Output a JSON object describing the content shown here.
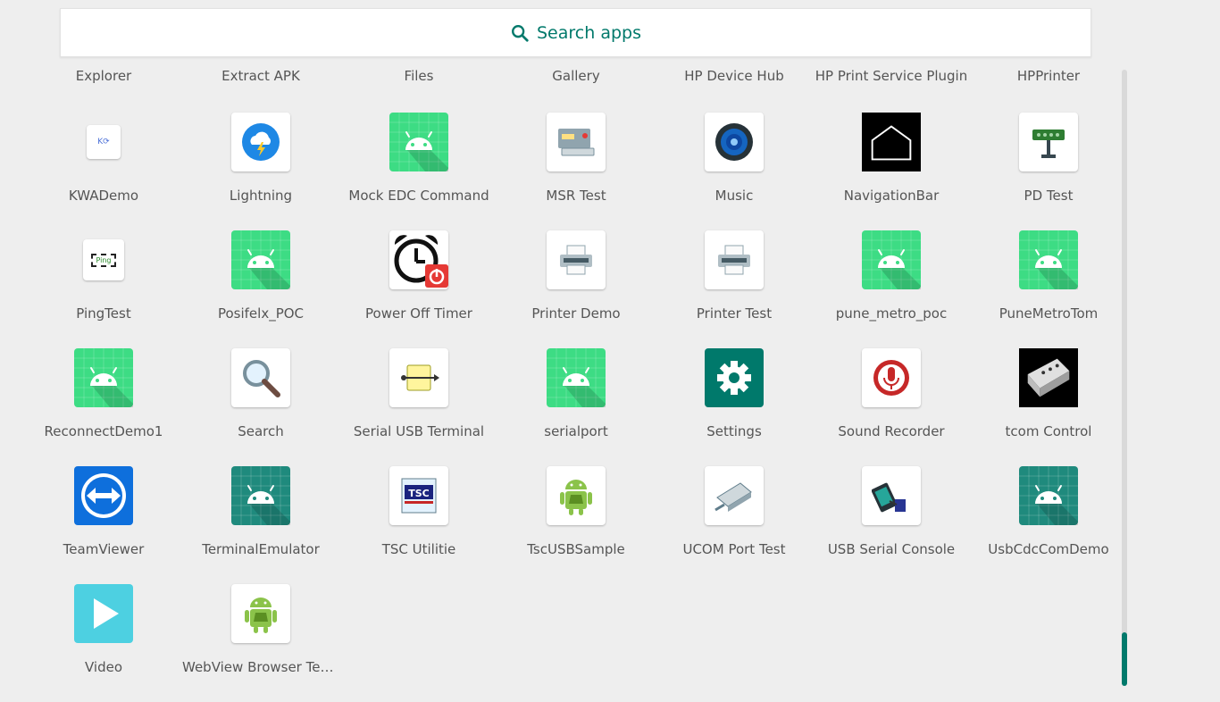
{
  "search": {
    "label": "Search apps"
  },
  "top_row": [
    "Explorer",
    "Extract APK",
    "Files",
    "Gallery",
    "HP Device Hub",
    "HP Print Service Plugin",
    "HPPrinter"
  ],
  "apps": [
    {
      "label": "KWADemo",
      "icon": "kwa-icon"
    },
    {
      "label": "Lightning",
      "icon": "lightning-icon"
    },
    {
      "label": "Mock EDC Command",
      "icon": "android-icon"
    },
    {
      "label": "MSR Test",
      "icon": "card-reader-icon"
    },
    {
      "label": "Music",
      "icon": "speaker-icon"
    },
    {
      "label": "NavigationBar",
      "icon": "home-outline-icon"
    },
    {
      "label": "PD Test",
      "icon": "display-sign-icon"
    },
    {
      "label": "PingTest",
      "icon": "ping-icon"
    },
    {
      "label": "Posifelx_POC",
      "icon": "android-icon"
    },
    {
      "label": "Power Off Timer",
      "icon": "alarm-power-icon"
    },
    {
      "label": "Printer Demo",
      "icon": "printer-icon"
    },
    {
      "label": "Printer Test",
      "icon": "printer-icon"
    },
    {
      "label": "pune_metro_poc",
      "icon": "android-icon"
    },
    {
      "label": "PuneMetroTom",
      "icon": "android-icon"
    },
    {
      "label": "ReconnectDemo1",
      "icon": "android-icon"
    },
    {
      "label": "Search",
      "icon": "magnifier-icon"
    },
    {
      "label": "Serial USB Terminal",
      "icon": "usb-icon"
    },
    {
      "label": "serialport",
      "icon": "android-icon"
    },
    {
      "label": "Settings",
      "icon": "gear-icon"
    },
    {
      "label": "Sound Recorder",
      "icon": "microphone-icon"
    },
    {
      "label": "tcom Control",
      "icon": "serial-connector-icon"
    },
    {
      "label": "TeamViewer",
      "icon": "teamviewer-icon"
    },
    {
      "label": "TerminalEmulator",
      "icon": "android-teal-icon"
    },
    {
      "label": "TSC Utilitie",
      "icon": "tsc-icon"
    },
    {
      "label": "TscUSBSample",
      "icon": "android-robot-icon"
    },
    {
      "label": "UCOM Port Test",
      "icon": "port-icon"
    },
    {
      "label": "USB Serial Console",
      "icon": "usb-console-icon"
    },
    {
      "label": "UsbCdcComDemo",
      "icon": "android-teal-icon"
    },
    {
      "label": "Video",
      "icon": "play-icon"
    },
    {
      "label": "WebView Browser Tes…",
      "icon": "android-robot-icon"
    }
  ],
  "colors": {
    "accent": "#00796b",
    "android_green": "#3ddc84",
    "teal": "#1f8a7d"
  }
}
